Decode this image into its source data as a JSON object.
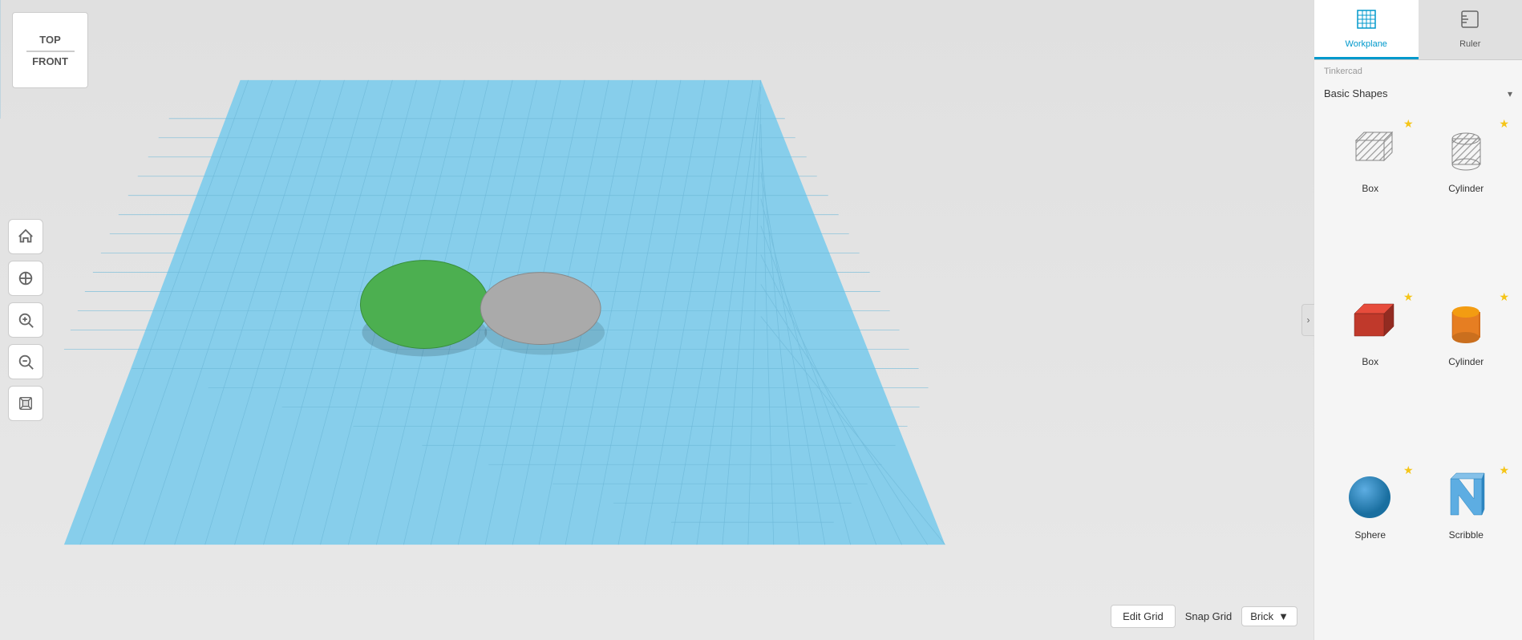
{
  "viewport": {
    "background_color": "#e8e8e8",
    "grid_color": "#87ceeb"
  },
  "view_cube": {
    "top_label": "TOP",
    "front_label": "FRONT"
  },
  "left_toolbar": {
    "buttons": [
      {
        "name": "home",
        "icon": "⌂",
        "label": "home-button"
      },
      {
        "name": "fit-all",
        "icon": "⊙",
        "label": "fit-all-button"
      },
      {
        "name": "zoom-in",
        "icon": "+",
        "label": "zoom-in-button"
      },
      {
        "name": "zoom-out",
        "icon": "−",
        "label": "zoom-out-button"
      },
      {
        "name": "perspective",
        "icon": "◉",
        "label": "perspective-button"
      }
    ]
  },
  "bottom_bar": {
    "edit_grid_label": "Edit Grid",
    "snap_grid_label": "Snap Grid",
    "snap_value": "Brick",
    "dropdown_arrow": "▼"
  },
  "right_panel": {
    "tabs": [
      {
        "name": "workplane",
        "label": "Workplane",
        "active": true
      },
      {
        "name": "ruler",
        "label": "Ruler",
        "active": false
      }
    ],
    "category_provider": "Tinkercad",
    "category_name": "Basic Shapes",
    "shapes": [
      {
        "id": "box-hole",
        "label": "Box",
        "type": "hole",
        "starred": true
      },
      {
        "id": "cylinder-hole",
        "label": "Cylinder",
        "type": "hole",
        "starred": true
      },
      {
        "id": "box-solid",
        "label": "Box",
        "type": "solid-red",
        "starred": true
      },
      {
        "id": "cylinder-solid",
        "label": "Cylinder",
        "type": "solid-orange",
        "starred": true
      },
      {
        "id": "sphere-solid",
        "label": "Sphere",
        "type": "solid-blue",
        "starred": true
      },
      {
        "id": "scribble",
        "label": "Scribble",
        "type": "scribble",
        "starred": true
      }
    ]
  },
  "scene_objects": [
    {
      "id": "green-disk",
      "color": "#4caf50",
      "shape": "ellipse"
    },
    {
      "id": "gray-disk",
      "color": "#aaaaaa",
      "shape": "ellipse"
    }
  ],
  "icons": {
    "workplane": "⊞",
    "ruler": "📐",
    "chevron_right": "›",
    "chevron_down": "▾",
    "star": "★",
    "home": "⌂",
    "fit": "⊙",
    "plus": "+",
    "minus": "−",
    "cube": "⬡"
  }
}
